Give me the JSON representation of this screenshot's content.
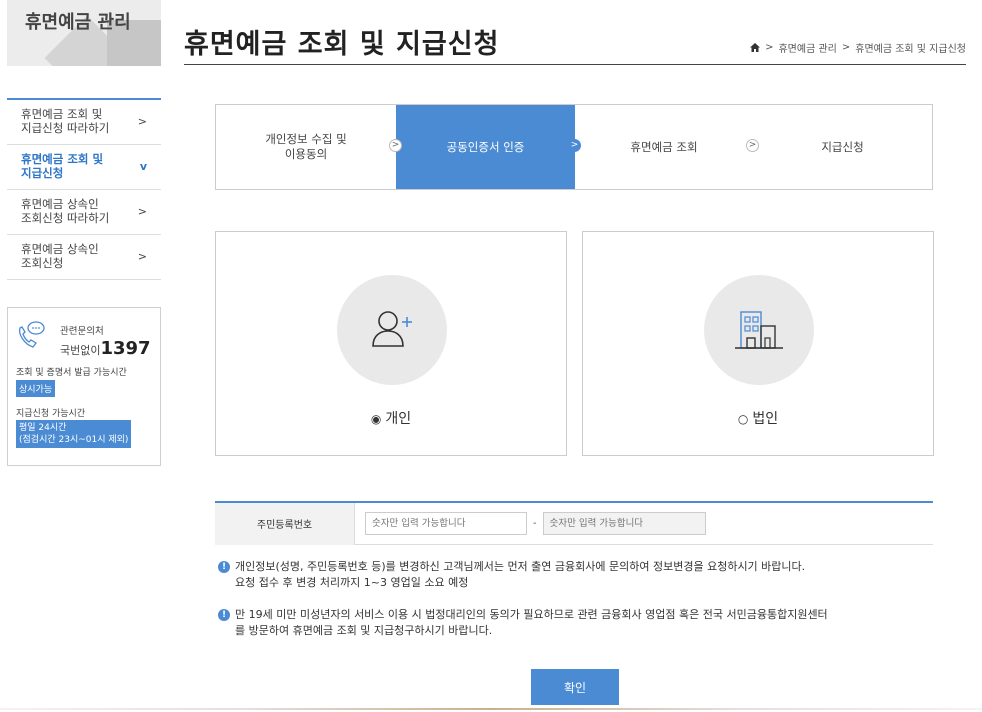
{
  "sidebar": {
    "title": "휴면예금 관리",
    "items": [
      {
        "line1": "휴면예금 조회 및",
        "line2": "지급신청 따라하기",
        "arrow": ">"
      },
      {
        "line1": "휴면예금 조회 및",
        "line2": "지급신청",
        "arrow": "v"
      },
      {
        "line1": "휴면예금 상속인",
        "line2": "조회신청 따라하기",
        "arrow": ">"
      },
      {
        "line1": "휴면예금 상속인",
        "line2": "조회신청",
        "arrow": ">"
      }
    ],
    "contact": {
      "label": "관련문의처",
      "number_prefix": "국번없이",
      "number": "1397",
      "line1": "조회 및 증명서 발급 가능시간",
      "badge1": "상시가능",
      "line2": "지급신청 가능시간",
      "badge2_line1": "평일 24시간",
      "badge2_line2": "(점검시간 23시~01시 제외)"
    }
  },
  "header": {
    "title": "휴면예금 조회 및 지급신청",
    "breadcrumb": {
      "sep": ">",
      "item1": "휴면예금 관리",
      "item2": "휴면예금 조회 및 지급신청"
    }
  },
  "steps": [
    {
      "line1": "개인정보 수집 및",
      "line2": "이용동의"
    },
    {
      "line1": "공동인증서 인증",
      "line2": ""
    },
    {
      "line1": "휴면예금 조회",
      "line2": ""
    },
    {
      "line1": "지급신청",
      "line2": ""
    }
  ],
  "choices": {
    "individual": {
      "label": "개인",
      "selected": true
    },
    "corporate": {
      "label": "법인",
      "selected": false
    }
  },
  "form": {
    "label": "주민등록번호",
    "field1_placeholder": "숫자만 입력 가능합니다",
    "dash": "-",
    "field2_placeholder": "숫자만 입력 가능합니다"
  },
  "notices": {
    "n1_line1": "개인정보(성명, 주민등록번호 등)를 변경하신 고객님께서는 먼저 출연 금융회사에 문의하여 정보변경을 요청하시기 바랍니다.",
    "n1_line2": "요청 접수 후 변경 처리까지 1~3 영업일 소요 예정",
    "n2_line1": "만 19세 미만 미성년자의 서비스 이용 시 법정대리인의 동의가 필요하므로 관련 금융회사 영업점 혹은 전국 서민금융통합지원센터",
    "n2_line2": "를 방문하여 휴면예금 조회 및 지급청구하시기 바랍니다."
  },
  "confirm_label": "확인",
  "colors": {
    "accent": "#4a8bd4"
  }
}
